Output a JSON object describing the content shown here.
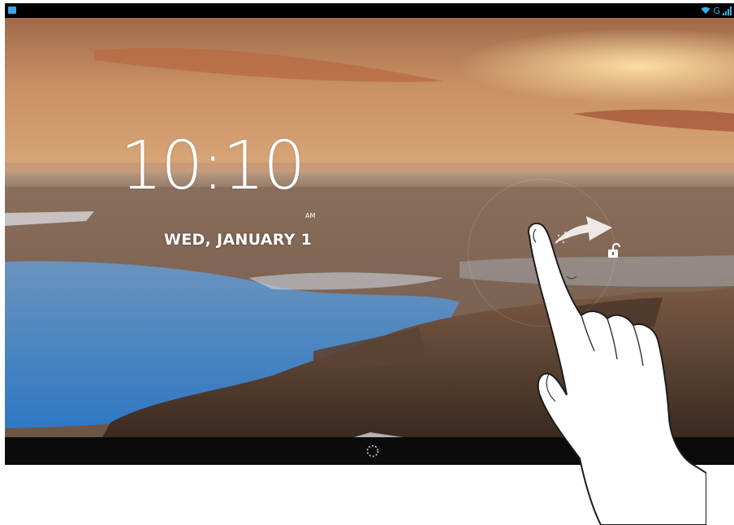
{
  "status_bar": {
    "left_icon": "notification-icon",
    "network_label": "G",
    "icons": [
      "wifi-icon",
      "signal-icon"
    ],
    "accent_color": "#33b5e5"
  },
  "lockscreen": {
    "time": "10:10",
    "ampm": "AM",
    "date": "WED, JANUARY 1",
    "unlock_icon": "unlock-padlock-icon",
    "swipe_hint_icon": "swipe-arrow-icon"
  },
  "nav_bar": {
    "home_icon": "home-ring-icon"
  },
  "overlay": {
    "gesture_icon": "pointing-hand-icon"
  }
}
